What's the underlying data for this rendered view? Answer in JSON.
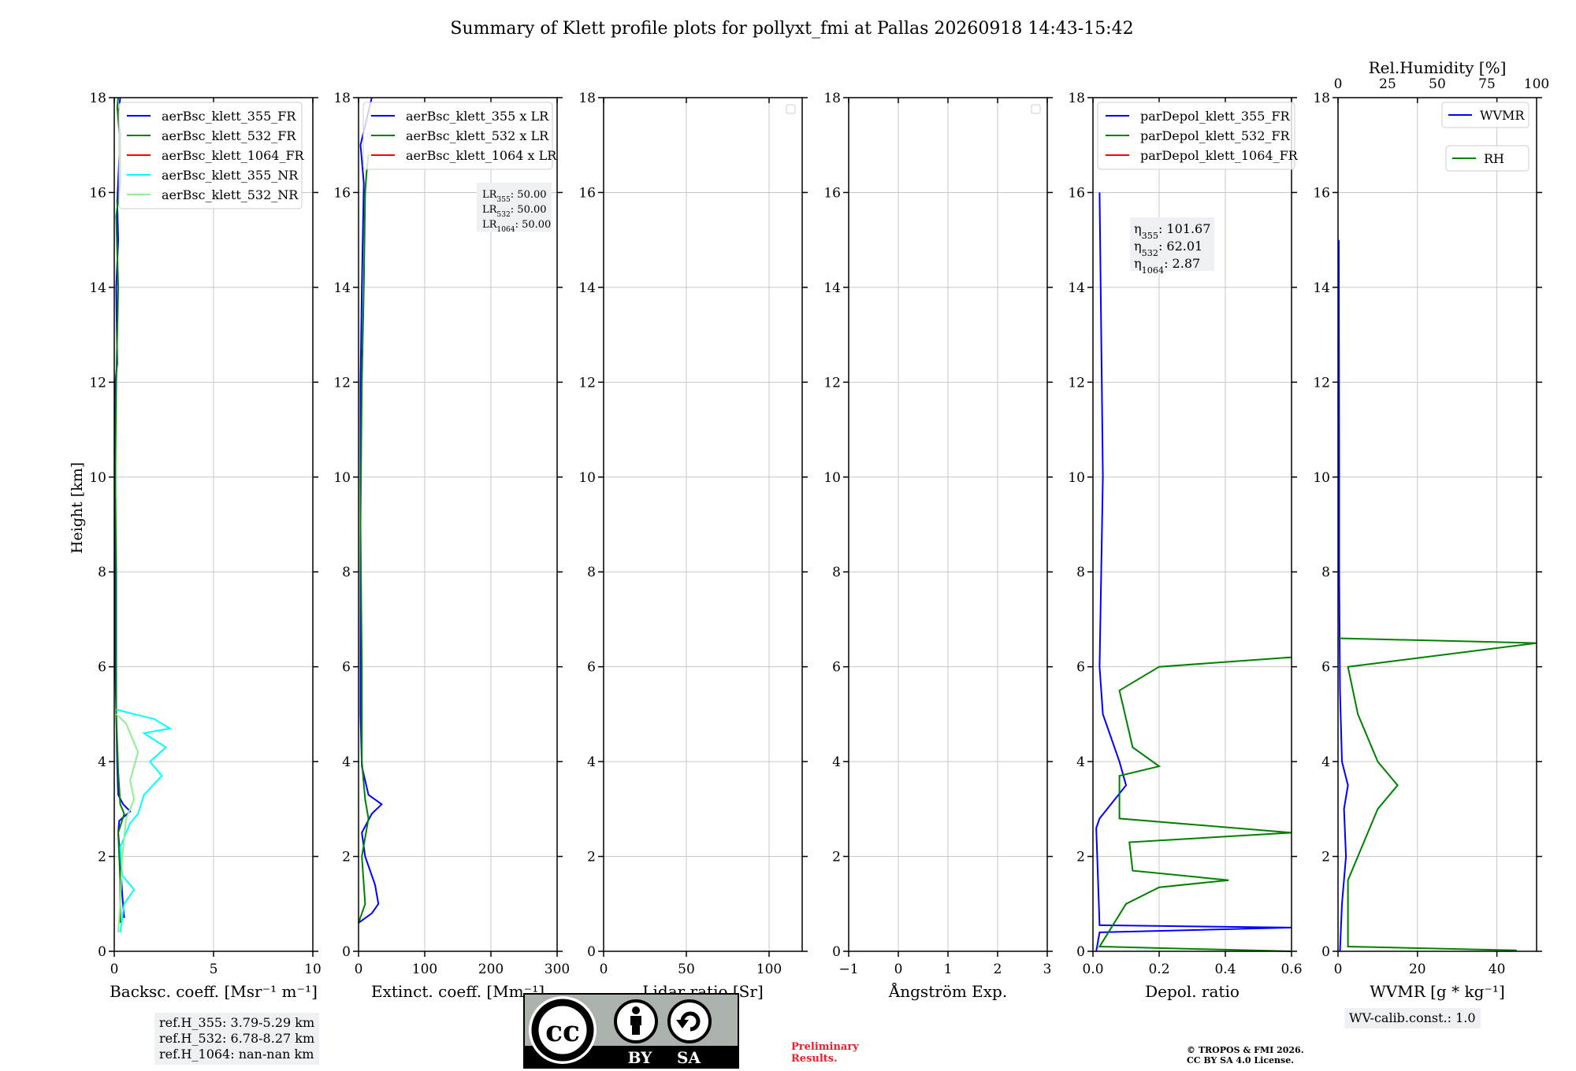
{
  "title": "Summary of Klett profile plots for pollyxt_fmi at Pallas 20260918 14:43-15:42",
  "ylabel": "Height [km]",
  "y_ticks": [
    "0",
    "2",
    "4",
    "6",
    "8",
    "10",
    "12",
    "14",
    "16",
    "18"
  ],
  "chart_data": [
    {
      "type": "line",
      "xlabel": "Backsc. coeff. [Msr⁻¹ m⁻¹]",
      "xlim": [
        0,
        10
      ],
      "x_ticks": [
        0,
        5,
        10
      ],
      "ylim": [
        0,
        18
      ],
      "grid": true,
      "legend": "top-left",
      "series": [
        {
          "name": "aerBsc_klett_355_FR",
          "color": "#0000ff",
          "points": [
            [
              0.5,
              0.7
            ],
            [
              0.4,
              1.2
            ],
            [
              0.3,
              2.0
            ],
            [
              0.2,
              2.5
            ],
            [
              0.25,
              2.75
            ],
            [
              0.8,
              2.95
            ],
            [
              0.45,
              3.1
            ],
            [
              0.2,
              3.3
            ],
            [
              0.15,
              3.9
            ],
            [
              0.1,
              5.0
            ],
            [
              0.05,
              6.0
            ],
            [
              0.05,
              8.0
            ],
            [
              0.05,
              12.0
            ],
            [
              0.15,
              12.4
            ],
            [
              0.1,
              14.0
            ],
            [
              0.2,
              15.0
            ],
            [
              0.15,
              15.8
            ],
            [
              0.3,
              17.2
            ],
            [
              0.2,
              17.6
            ],
            [
              0.3,
              18.0
            ]
          ]
        },
        {
          "name": "aerBsc_klett_532_FR",
          "color": "#008000",
          "points": [
            [
              0.3,
              0.6
            ],
            [
              0.3,
              1.5
            ],
            [
              0.2,
              2.5
            ],
            [
              0.5,
              2.9
            ],
            [
              0.3,
              3.1
            ],
            [
              0.2,
              3.8
            ],
            [
              0.1,
              5.0
            ],
            [
              0.1,
              8.0
            ],
            [
              0.05,
              10.0
            ],
            [
              0.1,
              12.0
            ],
            [
              0.15,
              13.0
            ],
            [
              0.2,
              14.0
            ],
            [
              0.1,
              15.5
            ],
            [
              0.3,
              16.2
            ],
            [
              0.3,
              17.0
            ],
            [
              0.15,
              17.8
            ],
            [
              0.2,
              18.0
            ]
          ]
        },
        {
          "name": "aerBsc_klett_1064_FR",
          "color": "#ff0000",
          "points": []
        },
        {
          "name": "aerBsc_klett_355_NR",
          "color": "#00ffff",
          "points": [
            [
              0.3,
              0.4
            ],
            [
              0.5,
              1.0
            ],
            [
              1.0,
              1.3
            ],
            [
              0.4,
              1.6
            ],
            [
              0.3,
              2.2
            ],
            [
              0.8,
              2.7
            ],
            [
              1.2,
              2.9
            ],
            [
              1.5,
              3.3
            ],
            [
              2.4,
              3.7
            ],
            [
              1.8,
              4.0
            ],
            [
              2.6,
              4.3
            ],
            [
              1.5,
              4.6
            ],
            [
              2.8,
              4.7
            ],
            [
              2.0,
              4.9
            ],
            [
              1.0,
              5.0
            ],
            [
              0.1,
              5.1
            ]
          ]
        },
        {
          "name": "aerBsc_klett_532_NR",
          "color": "#90ee90",
          "points": [
            [
              0.2,
              0.4
            ],
            [
              0.3,
              1.0
            ],
            [
              0.4,
              2.0
            ],
            [
              0.6,
              2.8
            ],
            [
              1.0,
              3.2
            ],
            [
              0.8,
              3.6
            ],
            [
              1.2,
              4.2
            ],
            [
              0.6,
              4.8
            ],
            [
              0.1,
              5.0
            ]
          ]
        }
      ],
      "ref_heights": [
        "ref.H_355: 3.79-5.29 km",
        "ref.H_532: 6.78-8.27 km",
        "ref.H_1064: nan-nan km"
      ]
    },
    {
      "type": "line",
      "xlabel": "Extinct. coeff. [Mm⁻¹]",
      "xlim": [
        0,
        300
      ],
      "x_ticks": [
        0,
        100,
        200,
        300
      ],
      "ylim": [
        0,
        18
      ],
      "grid": true,
      "legend": "top-left",
      "series": [
        {
          "name": "aerBsc_klett_355 x LR",
          "color": "#0000ff",
          "points": [
            [
              0,
              0.6
            ],
            [
              20,
              0.8
            ],
            [
              30,
              1.0
            ],
            [
              25,
              1.4
            ],
            [
              10,
              2.0
            ],
            [
              5,
              2.5
            ],
            [
              20,
              2.9
            ],
            [
              35,
              3.1
            ],
            [
              15,
              3.3
            ],
            [
              5,
              3.9
            ],
            [
              3,
              5.0
            ],
            [
              3,
              8.0
            ],
            [
              3,
              12.0
            ],
            [
              5,
              14.0
            ],
            [
              8,
              16.2
            ],
            [
              3,
              17.0
            ],
            [
              20,
              18.0
            ]
          ]
        },
        {
          "name": "aerBsc_klett_532 x LR",
          "color": "#008000",
          "points": [
            [
              0,
              0.6
            ],
            [
              10,
              1.0
            ],
            [
              5,
              2.0
            ],
            [
              15,
              2.8
            ],
            [
              10,
              3.2
            ],
            [
              5,
              4.0
            ],
            [
              5,
              6.0
            ],
            [
              3,
              9.0
            ],
            [
              5,
              12.0
            ],
            [
              8,
              14.0
            ],
            [
              10,
              16.0
            ],
            [
              12,
              16.4
            ],
            [
              15,
              16.8
            ]
          ]
        },
        {
          "name": "aerBsc_klett_1064 x LR",
          "color": "#ff0000",
          "points": []
        }
      ],
      "lidar_ratios": [
        "LR",
        "355",
        ": 50.00",
        "LR",
        "532",
        ": 50.00",
        "LR",
        "1064",
        ": 50.00"
      ]
    },
    {
      "type": "line",
      "xlabel": "Lidar ratio [Sr]",
      "xlim": [
        0,
        120
      ],
      "x_ticks": [
        0,
        50,
        100
      ],
      "ylim": [
        0,
        18
      ],
      "grid": true,
      "legend": "top-right",
      "series": []
    },
    {
      "type": "line",
      "xlabel": "Ångström Exp.",
      "xlim": [
        -1,
        3
      ],
      "x_ticks": [
        -1,
        0,
        1,
        2,
        3
      ],
      "ylim": [
        0,
        18
      ],
      "grid": true,
      "legend": "top-right",
      "series": []
    },
    {
      "type": "line",
      "xlabel": "Depol. ratio",
      "xlim": [
        0,
        0.6
      ],
      "x_ticks": [
        "0.0",
        "0.2",
        "0.4",
        "0.6"
      ],
      "ylim": [
        0,
        18
      ],
      "grid": true,
      "legend": "top-left",
      "series": [
        {
          "name": "parDepol_klett_355_FR",
          "color": "#0000ff",
          "points": [
            [
              0.01,
              0.0
            ],
            [
              0.02,
              0.4
            ],
            [
              0.6,
              0.5
            ],
            [
              0.02,
              0.55
            ],
            [
              0.01,
              2.6
            ],
            [
              0.02,
              2.8
            ],
            [
              0.1,
              3.5
            ],
            [
              0.08,
              4.0
            ],
            [
              0.03,
              5.0
            ],
            [
              0.02,
              6.0
            ],
            [
              0.03,
              10.0
            ],
            [
              0.02,
              16.0
            ]
          ]
        },
        {
          "name": "parDepol_klett_532_FR",
          "color": "#008000",
          "points": [
            [
              0.6,
              0.0
            ],
            [
              0.02,
              0.1
            ],
            [
              0.1,
              1.0
            ],
            [
              0.2,
              1.35
            ],
            [
              0.41,
              1.5
            ],
            [
              0.12,
              1.7
            ],
            [
              0.11,
              2.3
            ],
            [
              0.6,
              2.5
            ],
            [
              0.08,
              2.8
            ],
            [
              0.08,
              3.7
            ],
            [
              0.2,
              3.9
            ],
            [
              0.12,
              4.3
            ],
            [
              0.08,
              5.5
            ],
            [
              0.2,
              6.0
            ],
            [
              0.6,
              6.2
            ]
          ]
        },
        {
          "name": "parDepol_klett_1064_FR",
          "color": "#ff0000",
          "points": []
        }
      ],
      "eta": [
        "η",
        "355",
        ": 101.67",
        "η",
        "532",
        ": 62.01",
        "η",
        "1064",
        ": 2.87"
      ]
    },
    {
      "type": "line",
      "xlabel": "WVMR [g * kg⁻¹]",
      "xlim": [
        0,
        50
      ],
      "x_ticks": [
        0,
        20,
        40
      ],
      "ylim": [
        0,
        18
      ],
      "top_axis": {
        "label": "Rel.Humidity [%]",
        "lim": [
          0,
          100
        ],
        "ticks": [
          0,
          25,
          50,
          75,
          100
        ]
      },
      "grid": true,
      "legend": "top-right",
      "series": [
        {
          "name": "WVMR",
          "color": "#0000ff",
          "points": [
            [
              0.5,
              0.0
            ],
            [
              1.0,
              1.0
            ],
            [
              2.0,
              2.0
            ],
            [
              1.5,
              3.0
            ],
            [
              2.5,
              3.5
            ],
            [
              1.0,
              4.0
            ],
            [
              0.5,
              5.5
            ],
            [
              0.3,
              8.0
            ],
            [
              0.3,
              10.0
            ],
            [
              0.2,
              15.0
            ]
          ]
        },
        {
          "name": "RH",
          "color": "#008000",
          "points": [
            [
              90,
              0.02
            ],
            [
              5,
              0.1
            ],
            [
              5,
              1.5
            ],
            [
              15,
              2.5
            ],
            [
              20,
              3.0
            ],
            [
              30,
              3.5
            ],
            [
              20,
              4.0
            ],
            [
              10,
              5.0
            ],
            [
              5,
              6.0
            ],
            [
              100,
              6.5
            ],
            [
              0,
              6.6
            ]
          ]
        }
      ],
      "calib": "WV-calib.const.: 1.0"
    }
  ],
  "license_badge": {
    "cc": "cc",
    "by": "BY",
    "sa": "SA"
  },
  "preliminary": [
    "Preliminary",
    "Results."
  ],
  "copyright": [
    "© TROPOS & FMI 2026.",
    "CC BY SA 4.0 License."
  ]
}
